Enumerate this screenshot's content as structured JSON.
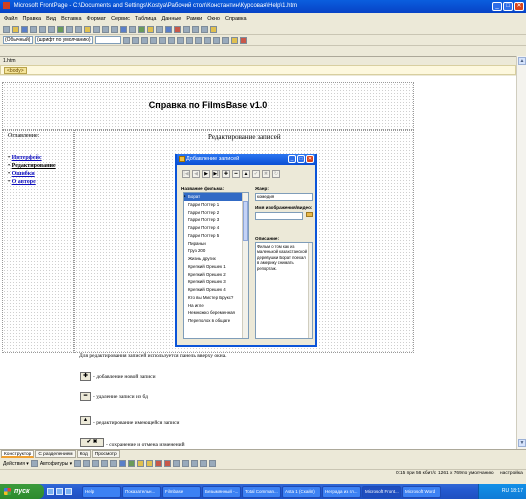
{
  "window": {
    "title": "Microsoft FrontPage - C:\\Documents and Settings\\Kostya\\Рабочий стол\\Константин\\Курсовая\\Help\\1.htm"
  },
  "menu": [
    "Файл",
    "Правка",
    "Вид",
    "Вставка",
    "Формат",
    "Сервис",
    "Таблица",
    "Данные",
    "Рамки",
    "Окно",
    "Справка"
  ],
  "format_toolbar": {
    "style_value": "(Обычный)",
    "font_value": "(шрифт по умолчанию)",
    "size_value": ""
  },
  "document": {
    "tab_label": "1.htm",
    "body_tag": "<body>",
    "page_title": "Справка по FilmsBase v1.0",
    "toc_title": "Оглавление:",
    "section_title": "Редактирование записей",
    "toc_items": [
      "Интерфейс",
      "Редактирование",
      "Ошибки",
      "О авторе"
    ],
    "intro_text": "Для редактирования записей используется панель вверху окна.",
    "legend": [
      {
        "glyph": "✚",
        "text": "- добавление новой записи"
      },
      {
        "glyph": "━",
        "text": "- удаление записи из бд"
      },
      {
        "glyph": "▲",
        "text": "- редактирование имеющейся записи"
      },
      {
        "glyph": "✔ ✖",
        "text": "- сохранение и отмена изменений"
      }
    ]
  },
  "dialog": {
    "title": "Добавление записей",
    "nav_buttons": [
      "|◀",
      "◀",
      "▶",
      "▶|",
      "✚",
      "━",
      "▲",
      "✔",
      "✖",
      "↻"
    ],
    "film_name_label": "Название фильма:",
    "genre_label": "Жанр:",
    "genre_value": "комедия",
    "image_label": "Имя изображения/видео:",
    "image_value": "",
    "description_label": "Описание:",
    "description_value": "Фильм о том как из маленькой казахстанской деревушки Борат поехал в америку снимать репортаж.",
    "films": [
      "Борат",
      "Гарри Поттер 1",
      "Гарри Поттер 2",
      "Гарри Поттер 3",
      "Гарри Поттер 4",
      "Гарри Поттер 5",
      "Пираньи",
      "Груз 200",
      "Жизнь других",
      "Крепкий Орешек 1",
      "Крепкий Орешек 2",
      "Крепкий Орешек 3",
      "Крепкий Орешек 4",
      "Кто вы Мистер Брукс?",
      "На игле",
      "Немножко беременная",
      "Переполох в общаге"
    ],
    "selected_index": 0
  },
  "view_tabs": [
    "Конструктор",
    "С разделением",
    "Код",
    "Просмотр"
  ],
  "draw_toolbar": {
    "actions_label": "Действия ▾",
    "autoshapes_label": "Автофигуры ▾"
  },
  "status": {
    "load_time": "0:15 при 56 кбит/с",
    "resolution": "1261 x 769",
    "mode": "по умолчанию",
    "custom": "настройка"
  },
  "taskbar": {
    "start_label": "пуск",
    "tasks": [
      "Help",
      "Показательн...",
      "Filmbase",
      "Безымянный -...",
      "Total Comman...",
      "Asta 1 (Скайп)",
      "Неграда из гл...",
      "Microsoft Front...",
      "Microsoft Word"
    ],
    "active_index": 7,
    "clock": "RU  18:17"
  }
}
